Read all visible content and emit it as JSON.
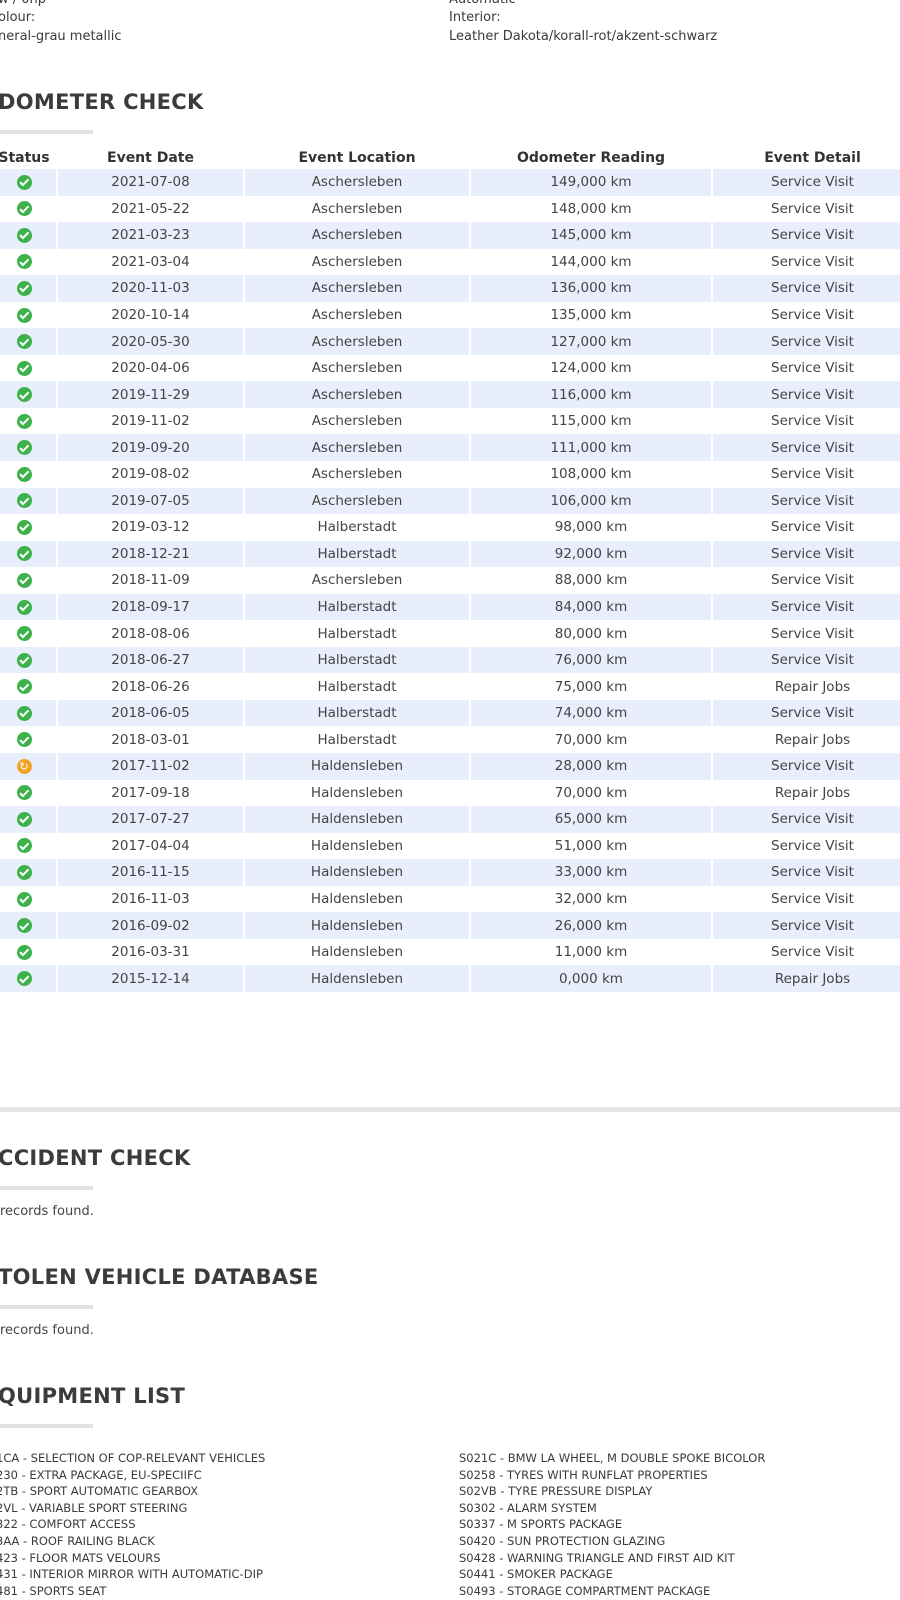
{
  "specs": {
    "row0_left_value": "w / 0hp",
    "row0_right_value": "Automatic",
    "colour_label": "olour:",
    "colour_value": "neral-grau metallic",
    "interior_label": "Interior:",
    "interior_value": "Leather Dakota/korall-rot/akzent-schwarz"
  },
  "odometer": {
    "title": "DOMETER CHECK",
    "headers": [
      "Status",
      "Event Date",
      "Event Location",
      "Odometer Reading",
      "Event Detail"
    ],
    "rows": [
      {
        "status": "ok",
        "date": "2021-07-08",
        "location": "Aschersleben",
        "reading": "149,000 km",
        "detail": "Service Visit"
      },
      {
        "status": "ok",
        "date": "2021-05-22",
        "location": "Aschersleben",
        "reading": "148,000 km",
        "detail": "Service Visit"
      },
      {
        "status": "ok",
        "date": "2021-03-23",
        "location": "Aschersleben",
        "reading": "145,000 km",
        "detail": "Service Visit"
      },
      {
        "status": "ok",
        "date": "2021-03-04",
        "location": "Aschersleben",
        "reading": "144,000 km",
        "detail": "Service Visit"
      },
      {
        "status": "ok",
        "date": "2020-11-03",
        "location": "Aschersleben",
        "reading": "136,000 km",
        "detail": "Service Visit"
      },
      {
        "status": "ok",
        "date": "2020-10-14",
        "location": "Aschersleben",
        "reading": "135,000 km",
        "detail": "Service Visit"
      },
      {
        "status": "ok",
        "date": "2020-05-30",
        "location": "Aschersleben",
        "reading": "127,000 km",
        "detail": "Service Visit"
      },
      {
        "status": "ok",
        "date": "2020-04-06",
        "location": "Aschersleben",
        "reading": "124,000 km",
        "detail": "Service Visit"
      },
      {
        "status": "ok",
        "date": "2019-11-29",
        "location": "Aschersleben",
        "reading": "116,000 km",
        "detail": "Service Visit"
      },
      {
        "status": "ok",
        "date": "2019-11-02",
        "location": "Aschersleben",
        "reading": "115,000 km",
        "detail": "Service Visit"
      },
      {
        "status": "ok",
        "date": "2019-09-20",
        "location": "Aschersleben",
        "reading": "111,000 km",
        "detail": "Service Visit"
      },
      {
        "status": "ok",
        "date": "2019-08-02",
        "location": "Aschersleben",
        "reading": "108,000 km",
        "detail": "Service Visit"
      },
      {
        "status": "ok",
        "date": "2019-07-05",
        "location": "Aschersleben",
        "reading": "106,000 km",
        "detail": "Service Visit"
      },
      {
        "status": "ok",
        "date": "2019-03-12",
        "location": "Halberstadt",
        "reading": "98,000 km",
        "detail": "Service Visit"
      },
      {
        "status": "ok",
        "date": "2018-12-21",
        "location": "Halberstadt",
        "reading": "92,000 km",
        "detail": "Service Visit"
      },
      {
        "status": "ok",
        "date": "2018-11-09",
        "location": "Aschersleben",
        "reading": "88,000 km",
        "detail": "Service Visit"
      },
      {
        "status": "ok",
        "date": "2018-09-17",
        "location": "Halberstadt",
        "reading": "84,000 km",
        "detail": "Service Visit"
      },
      {
        "status": "ok",
        "date": "2018-08-06",
        "location": "Halberstadt",
        "reading": "80,000 km",
        "detail": "Service Visit"
      },
      {
        "status": "ok",
        "date": "2018-06-27",
        "location": "Halberstadt",
        "reading": "76,000 km",
        "detail": "Service Visit"
      },
      {
        "status": "ok",
        "date": "2018-06-26",
        "location": "Halberstadt",
        "reading": "75,000 km",
        "detail": "Repair Jobs"
      },
      {
        "status": "ok",
        "date": "2018-06-05",
        "location": "Halberstadt",
        "reading": "74,000 km",
        "detail": "Service Visit"
      },
      {
        "status": "ok",
        "date": "2018-03-01",
        "location": "Halberstadt",
        "reading": "70,000 km",
        "detail": "Repair Jobs"
      },
      {
        "status": "warn",
        "date": "2017-11-02",
        "location": "Haldensleben",
        "reading": "28,000 km",
        "detail": "Service Visit"
      },
      {
        "status": "ok",
        "date": "2017-09-18",
        "location": "Haldensleben",
        "reading": "70,000 km",
        "detail": "Repair Jobs"
      },
      {
        "status": "ok",
        "date": "2017-07-27",
        "location": "Haldensleben",
        "reading": "65,000 km",
        "detail": "Service Visit"
      },
      {
        "status": "ok",
        "date": "2017-04-04",
        "location": "Haldensleben",
        "reading": "51,000 km",
        "detail": "Service Visit"
      },
      {
        "status": "ok",
        "date": "2016-11-15",
        "location": "Haldensleben",
        "reading": "33,000 km",
        "detail": "Service Visit"
      },
      {
        "status": "ok",
        "date": "2016-11-03",
        "location": "Haldensleben",
        "reading": "32,000 km",
        "detail": "Service Visit"
      },
      {
        "status": "ok",
        "date": "2016-09-02",
        "location": "Haldensleben",
        "reading": "26,000 km",
        "detail": "Service Visit"
      },
      {
        "status": "ok",
        "date": "2016-03-31",
        "location": "Haldensleben",
        "reading": "11,000 km",
        "detail": "Service Visit"
      },
      {
        "status": "ok",
        "date": "2015-12-14",
        "location": "Haldensleben",
        "reading": "0,000 km",
        "detail": "Repair Jobs"
      }
    ]
  },
  "accident": {
    "title": "CCIDENT CHECK",
    "note": " records found."
  },
  "stolen": {
    "title": "TOLEN VEHICLE DATABASE",
    "note": " records found."
  },
  "equipment": {
    "title": "QUIPMENT LIST",
    "left": [
      "1CA - SELECTION OF COP-RELEVANT VEHICLES",
      "230 - EXTRA PACKAGE, EU-SPECIIFC",
      "2TB - SPORT AUTOMATIC GEARBOX",
      "2VL - VARIABLE SPORT STEERING",
      "322 - COMFORT ACCESS",
      "3AA - ROOF RAILING BLACK",
      "423 - FLOOR MATS VELOURS",
      "431 - INTERIOR MIRROR WITH AUTOMATIC-DIP",
      "481 - SPORTS SEAT"
    ],
    "right": [
      "S021C - BMW LA WHEEL, M DOUBLE SPOKE BICOLOR",
      "S0258 - TYRES WITH RUNFLAT PROPERTIES",
      "S02VB - TYRE PRESSURE DISPLAY",
      "S0302 - ALARM SYSTEM",
      "S0337 - M SPORTS PACKAGE",
      "S0420 - SUN PROTECTION GLAZING",
      "S0428 - WARNING TRIANGLE AND FIRST AID KIT",
      "S0441 - SMOKER PACKAGE",
      "S0493 - STORAGE COMPARTMENT PACKAGE"
    ]
  },
  "colors": {
    "row_stripe": "#e8eefb",
    "ok_icon": "#3db24b",
    "warn_icon": "#f0a324",
    "heading": "#3b3b3b"
  }
}
